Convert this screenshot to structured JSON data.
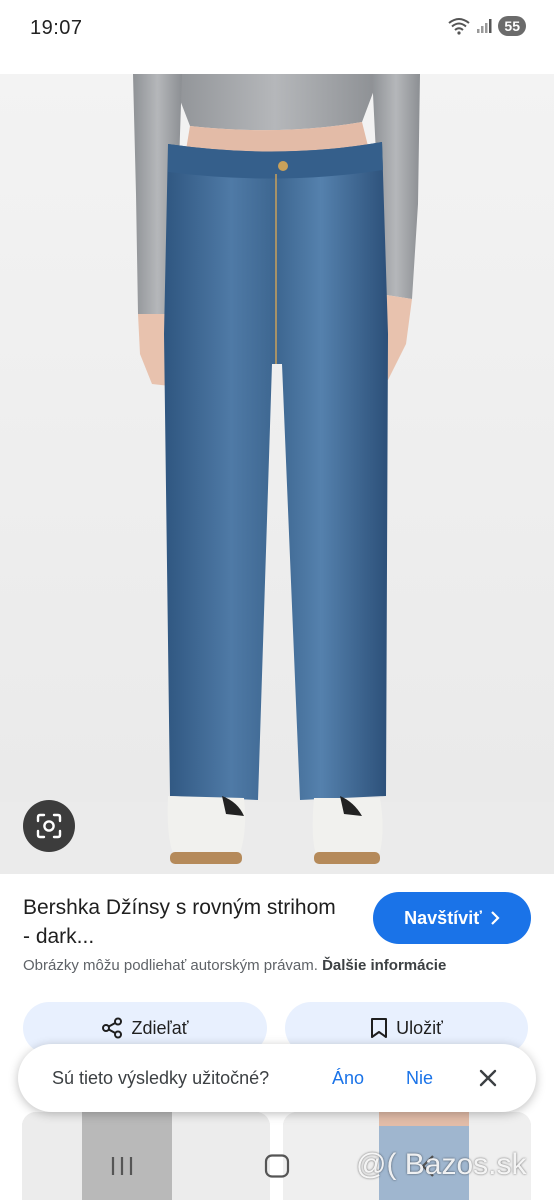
{
  "status_bar": {
    "time": "19:07",
    "battery": "55",
    "icons": [
      "wifi-icon",
      "signal-icon",
      "battery-icon"
    ]
  },
  "product": {
    "title": "Bershka Džínsy s rovným strihom - dark...",
    "visit_label": "Navštíviť",
    "copyright_text": "Obrázky môžu podliehať autorským právam.",
    "more_info_label": "Ďalšie informácie"
  },
  "actions": {
    "share_label": "Zdieľať",
    "save_label": "Uložiť"
  },
  "feedback": {
    "question": "Sú tieto výsledky užitočné?",
    "yes_label": "Áno",
    "no_label": "Nie"
  },
  "watermark": "@( Bazos.sk",
  "colors": {
    "accent": "#1a73e8",
    "action_bg": "#e8f0fe",
    "denim": "#3f6a96"
  }
}
